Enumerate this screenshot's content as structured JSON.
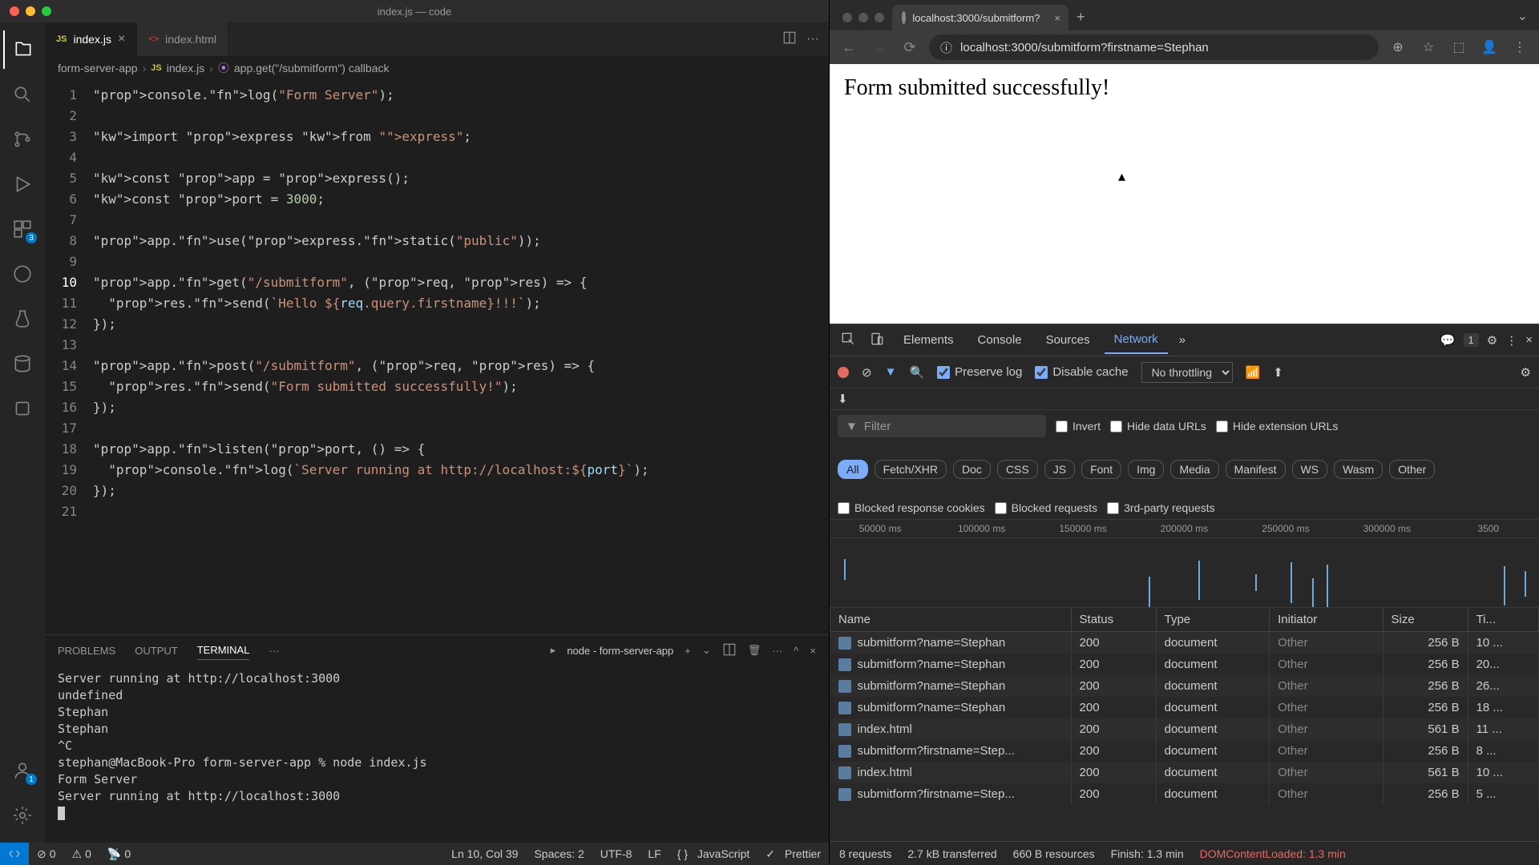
{
  "vscode": {
    "window_title": "index.js — code",
    "tabs": [
      {
        "icon": "JS",
        "label": "index.js",
        "active": true
      },
      {
        "icon": "<>",
        "label": "index.html",
        "active": false
      }
    ],
    "breadcrumb": {
      "folder": "form-server-app",
      "file": "index.js",
      "symbol": "app.get(\"/submitform\") callback"
    },
    "code_lines": [
      "console.log(\"Form Server\");",
      "",
      "import express from \"express\";",
      "",
      "const app = express();",
      "const port = 3000;",
      "",
      "app.use(express.static(\"public\"));",
      "",
      "app.get(\"/submitform\", (req, res) => {",
      "  res.send(`Hello ${req.query.firstname}!!!`);",
      "});",
      "",
      "app.post(\"/submitform\", (req, res) => {",
      "  res.send(\"Form submitted successfully!\");",
      "});",
      "",
      "app.listen(port, () => {",
      "  console.log(`Server running at http://localhost:${port}`);",
      "});",
      ""
    ],
    "active_line": 10,
    "activity_badges": {
      "extensions": "3",
      "accounts": "1"
    },
    "panel": {
      "tabs": [
        "PROBLEMS",
        "OUTPUT",
        "TERMINAL",
        "···"
      ],
      "active_tab": "TERMINAL",
      "process": "node - form-server-app",
      "terminal_lines": [
        "Server running at http://localhost:3000",
        "undefined",
        "Stephan",
        "Stephan",
        "^C",
        "stephan@MacBook-Pro form-server-app % node index.js",
        "Form Server",
        "Server running at http://localhost:3000"
      ]
    },
    "statusbar": {
      "errors": "0",
      "warnings": "0",
      "ports": "0",
      "cursor": "Ln 10, Col 39",
      "spaces": "Spaces: 2",
      "encoding": "UTF-8",
      "eol": "LF",
      "lang": "JavaScript",
      "prettier": "Prettier"
    }
  },
  "chrome": {
    "tab_title": "localhost:3000/submitform?",
    "url": "localhost:3000/submitform?firstname=Stephan",
    "page_heading": "Form submitted successfully!"
  },
  "devtools": {
    "tabs": [
      "Elements",
      "Console",
      "Sources",
      "Network"
    ],
    "active_tab": "Network",
    "issues_count": "1",
    "preserve_log": "Preserve log",
    "disable_cache": "Disable cache",
    "throttling": "No throttling",
    "filter_placeholder": "Filter",
    "filter_checks": [
      "Invert",
      "Hide data URLs",
      "Hide extension URLs"
    ],
    "type_filters": [
      "All",
      "Fetch/XHR",
      "Doc",
      "CSS",
      "JS",
      "Font",
      "Img",
      "Media",
      "Manifest",
      "WS",
      "Wasm",
      "Other"
    ],
    "active_type_filter": "All",
    "block_checks": [
      "Blocked response cookies",
      "Blocked requests",
      "3rd-party requests"
    ],
    "timeline_ticks": [
      "50000 ms",
      "100000 ms",
      "150000 ms",
      "200000 ms",
      "250000 ms",
      "300000 ms",
      "3500"
    ],
    "columns": [
      "Name",
      "Status",
      "Type",
      "Initiator",
      "Size",
      "Ti..."
    ],
    "requests": [
      {
        "name": "submitform?name=Stephan",
        "status": "200",
        "type": "document",
        "initiator": "Other",
        "size": "256 B",
        "time": "10 ..."
      },
      {
        "name": "submitform?name=Stephan",
        "status": "200",
        "type": "document",
        "initiator": "Other",
        "size": "256 B",
        "time": "20..."
      },
      {
        "name": "submitform?name=Stephan",
        "status": "200",
        "type": "document",
        "initiator": "Other",
        "size": "256 B",
        "time": "26..."
      },
      {
        "name": "submitform?name=Stephan",
        "status": "200",
        "type": "document",
        "initiator": "Other",
        "size": "256 B",
        "time": "18 ..."
      },
      {
        "name": "index.html",
        "status": "200",
        "type": "document",
        "initiator": "Other",
        "size": "561 B",
        "time": "11 ..."
      },
      {
        "name": "submitform?firstname=Step...",
        "status": "200",
        "type": "document",
        "initiator": "Other",
        "size": "256 B",
        "time": "8 ..."
      },
      {
        "name": "index.html",
        "status": "200",
        "type": "document",
        "initiator": "Other",
        "size": "561 B",
        "time": "10 ..."
      },
      {
        "name": "submitform?firstname=Step...",
        "status": "200",
        "type": "document",
        "initiator": "Other",
        "size": "256 B",
        "time": "5 ..."
      }
    ],
    "footer": {
      "requests": "8 requests",
      "transferred": "2.7 kB transferred",
      "resources": "660 B resources",
      "finish": "Finish: 1.3 min",
      "dom": "DOMContentLoaded: 1.3 min"
    }
  }
}
